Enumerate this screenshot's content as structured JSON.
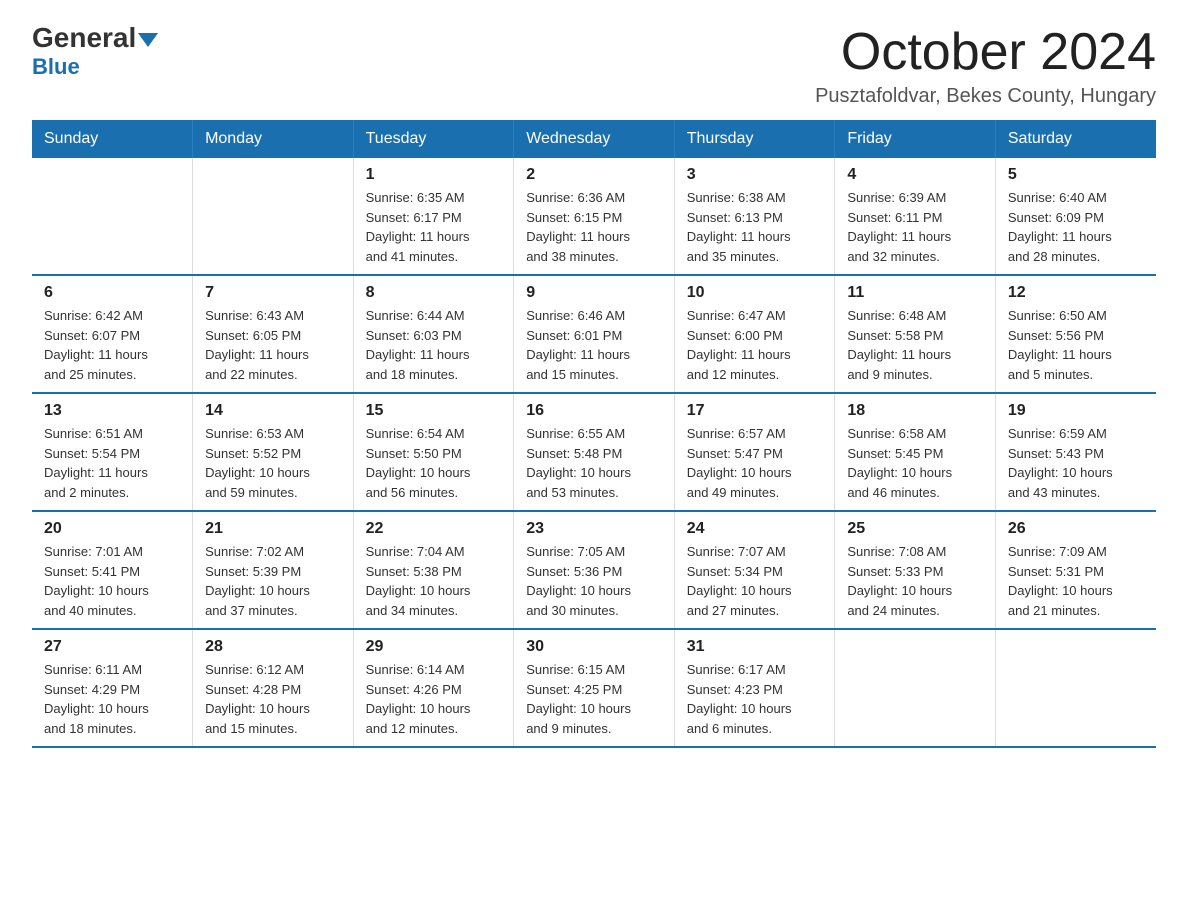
{
  "logo": {
    "general": "General",
    "blue": "Blue"
  },
  "header": {
    "title": "October 2024",
    "subtitle": "Pusztafoldvar, Bekes County, Hungary"
  },
  "days_of_week": [
    "Sunday",
    "Monday",
    "Tuesday",
    "Wednesday",
    "Thursday",
    "Friday",
    "Saturday"
  ],
  "weeks": [
    [
      {
        "day": "",
        "info": ""
      },
      {
        "day": "",
        "info": ""
      },
      {
        "day": "1",
        "info": "Sunrise: 6:35 AM\nSunset: 6:17 PM\nDaylight: 11 hours\nand 41 minutes."
      },
      {
        "day": "2",
        "info": "Sunrise: 6:36 AM\nSunset: 6:15 PM\nDaylight: 11 hours\nand 38 minutes."
      },
      {
        "day": "3",
        "info": "Sunrise: 6:38 AM\nSunset: 6:13 PM\nDaylight: 11 hours\nand 35 minutes."
      },
      {
        "day": "4",
        "info": "Sunrise: 6:39 AM\nSunset: 6:11 PM\nDaylight: 11 hours\nand 32 minutes."
      },
      {
        "day": "5",
        "info": "Sunrise: 6:40 AM\nSunset: 6:09 PM\nDaylight: 11 hours\nand 28 minutes."
      }
    ],
    [
      {
        "day": "6",
        "info": "Sunrise: 6:42 AM\nSunset: 6:07 PM\nDaylight: 11 hours\nand 25 minutes."
      },
      {
        "day": "7",
        "info": "Sunrise: 6:43 AM\nSunset: 6:05 PM\nDaylight: 11 hours\nand 22 minutes."
      },
      {
        "day": "8",
        "info": "Sunrise: 6:44 AM\nSunset: 6:03 PM\nDaylight: 11 hours\nand 18 minutes."
      },
      {
        "day": "9",
        "info": "Sunrise: 6:46 AM\nSunset: 6:01 PM\nDaylight: 11 hours\nand 15 minutes."
      },
      {
        "day": "10",
        "info": "Sunrise: 6:47 AM\nSunset: 6:00 PM\nDaylight: 11 hours\nand 12 minutes."
      },
      {
        "day": "11",
        "info": "Sunrise: 6:48 AM\nSunset: 5:58 PM\nDaylight: 11 hours\nand 9 minutes."
      },
      {
        "day": "12",
        "info": "Sunrise: 6:50 AM\nSunset: 5:56 PM\nDaylight: 11 hours\nand 5 minutes."
      }
    ],
    [
      {
        "day": "13",
        "info": "Sunrise: 6:51 AM\nSunset: 5:54 PM\nDaylight: 11 hours\nand 2 minutes."
      },
      {
        "day": "14",
        "info": "Sunrise: 6:53 AM\nSunset: 5:52 PM\nDaylight: 10 hours\nand 59 minutes."
      },
      {
        "day": "15",
        "info": "Sunrise: 6:54 AM\nSunset: 5:50 PM\nDaylight: 10 hours\nand 56 minutes."
      },
      {
        "day": "16",
        "info": "Sunrise: 6:55 AM\nSunset: 5:48 PM\nDaylight: 10 hours\nand 53 minutes."
      },
      {
        "day": "17",
        "info": "Sunrise: 6:57 AM\nSunset: 5:47 PM\nDaylight: 10 hours\nand 49 minutes."
      },
      {
        "day": "18",
        "info": "Sunrise: 6:58 AM\nSunset: 5:45 PM\nDaylight: 10 hours\nand 46 minutes."
      },
      {
        "day": "19",
        "info": "Sunrise: 6:59 AM\nSunset: 5:43 PM\nDaylight: 10 hours\nand 43 minutes."
      }
    ],
    [
      {
        "day": "20",
        "info": "Sunrise: 7:01 AM\nSunset: 5:41 PM\nDaylight: 10 hours\nand 40 minutes."
      },
      {
        "day": "21",
        "info": "Sunrise: 7:02 AM\nSunset: 5:39 PM\nDaylight: 10 hours\nand 37 minutes."
      },
      {
        "day": "22",
        "info": "Sunrise: 7:04 AM\nSunset: 5:38 PM\nDaylight: 10 hours\nand 34 minutes."
      },
      {
        "day": "23",
        "info": "Sunrise: 7:05 AM\nSunset: 5:36 PM\nDaylight: 10 hours\nand 30 minutes."
      },
      {
        "day": "24",
        "info": "Sunrise: 7:07 AM\nSunset: 5:34 PM\nDaylight: 10 hours\nand 27 minutes."
      },
      {
        "day": "25",
        "info": "Sunrise: 7:08 AM\nSunset: 5:33 PM\nDaylight: 10 hours\nand 24 minutes."
      },
      {
        "day": "26",
        "info": "Sunrise: 7:09 AM\nSunset: 5:31 PM\nDaylight: 10 hours\nand 21 minutes."
      }
    ],
    [
      {
        "day": "27",
        "info": "Sunrise: 6:11 AM\nSunset: 4:29 PM\nDaylight: 10 hours\nand 18 minutes."
      },
      {
        "day": "28",
        "info": "Sunrise: 6:12 AM\nSunset: 4:28 PM\nDaylight: 10 hours\nand 15 minutes."
      },
      {
        "day": "29",
        "info": "Sunrise: 6:14 AM\nSunset: 4:26 PM\nDaylight: 10 hours\nand 12 minutes."
      },
      {
        "day": "30",
        "info": "Sunrise: 6:15 AM\nSunset: 4:25 PM\nDaylight: 10 hours\nand 9 minutes."
      },
      {
        "day": "31",
        "info": "Sunrise: 6:17 AM\nSunset: 4:23 PM\nDaylight: 10 hours\nand 6 minutes."
      },
      {
        "day": "",
        "info": ""
      },
      {
        "day": "",
        "info": ""
      }
    ]
  ]
}
